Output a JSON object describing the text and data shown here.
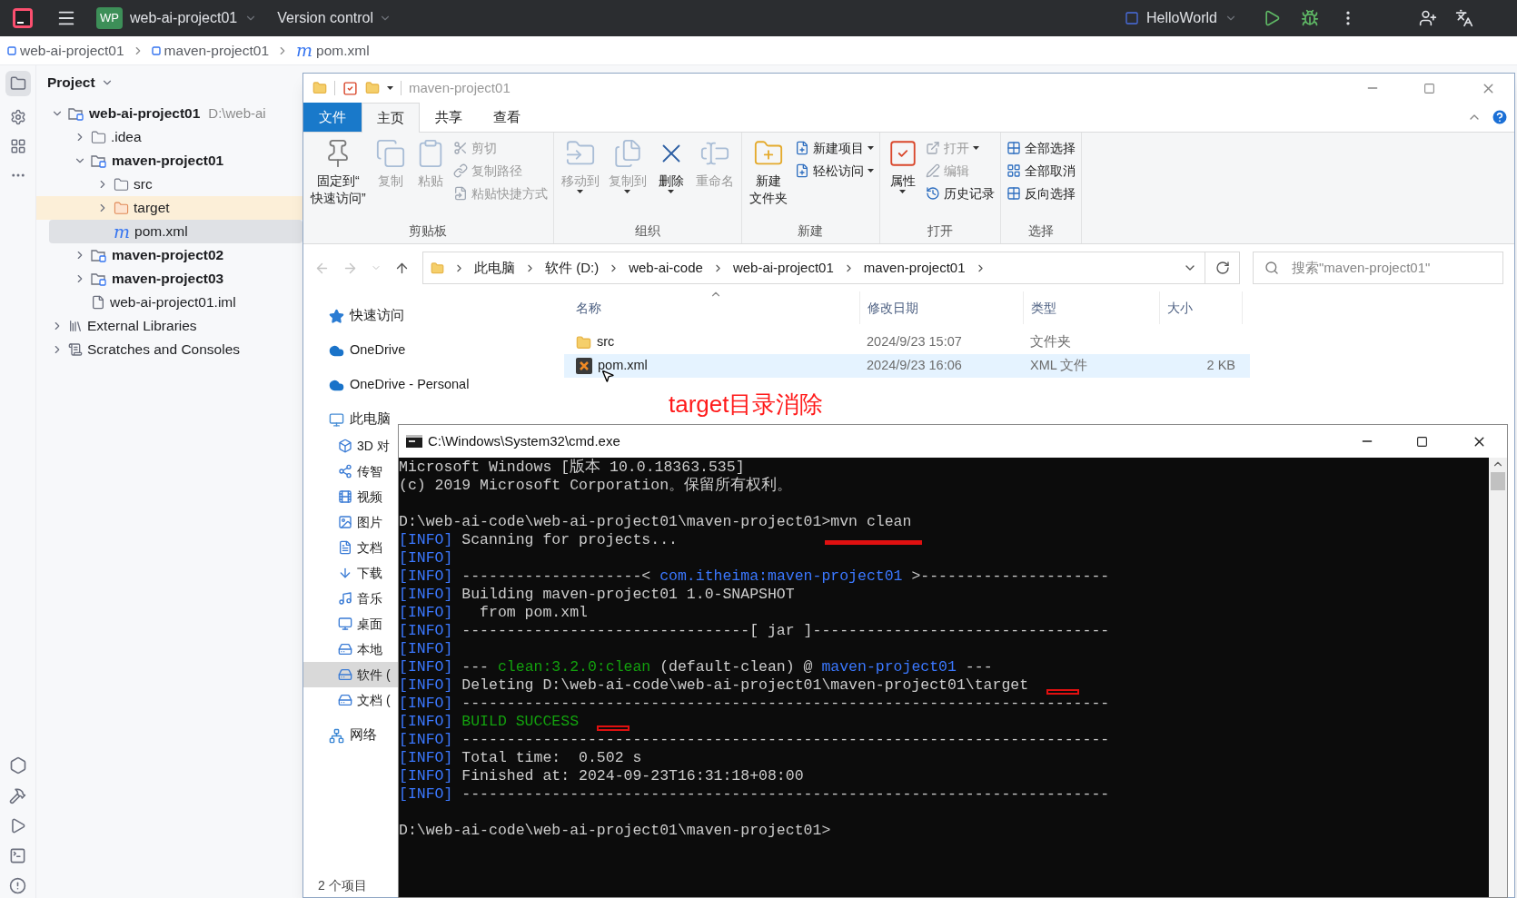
{
  "ide": {
    "top_bar": {
      "project_badge": "WP",
      "project": "web-ai-project01",
      "vcs": "Version control",
      "run_config": "HelloWorld"
    },
    "breadcrumbs": [
      {
        "label": "web-ai-project01",
        "kind": "module"
      },
      {
        "label": "maven-project01",
        "kind": "module"
      },
      {
        "label": "pom.xml",
        "kind": "maven",
        "glyph": "m"
      }
    ],
    "project_panel": {
      "title": "Project",
      "tree": [
        {
          "label": "web-ai-project01",
          "kind": "module",
          "bold": true,
          "expanded": true,
          "selected": false,
          "excluded": false,
          "suffix": "D:\\web-ai",
          "children": [
            {
              "label": ".idea",
              "kind": "folder",
              "bold": false,
              "expanded": false,
              "selected": false,
              "excluded": false
            },
            {
              "label": "maven-project01",
              "kind": "module",
              "bold": true,
              "expanded": true,
              "selected": false,
              "excluded": false,
              "children": [
                {
                  "label": "src",
                  "kind": "folder",
                  "bold": false,
                  "expanded": false,
                  "selected": false,
                  "excluded": false
                },
                {
                  "label": "target",
                  "kind": "folder",
                  "bold": false,
                  "expanded": false,
                  "selected": false,
                  "excluded": true
                },
                {
                  "label": "pom.xml",
                  "kind": "maven",
                  "glyph": "m",
                  "bold": false,
                  "selected": true,
                  "excluded": false
                }
              ]
            },
            {
              "label": "maven-project02",
              "kind": "module",
              "bold": true,
              "expanded": false,
              "selected": false,
              "excluded": false
            },
            {
              "label": "maven-project03",
              "kind": "module",
              "bold": true,
              "expanded": false,
              "selected": false,
              "excluded": false
            },
            {
              "label": "web-ai-project01.iml",
              "kind": "iml",
              "bold": false,
              "selected": false,
              "excluded": false
            }
          ]
        },
        {
          "label": "External Libraries",
          "kind": "libraries",
          "bold": false,
          "expanded": false,
          "selected": false,
          "excluded": false
        },
        {
          "label": "Scratches and Consoles",
          "kind": "scratches",
          "bold": false,
          "expanded": false,
          "selected": false,
          "excluded": false
        }
      ]
    }
  },
  "explorer": {
    "title": "maven-project01",
    "tabs": [
      {
        "label": "文件",
        "kind": "file_menu",
        "selected": false
      },
      {
        "label": "主页",
        "kind": "tab",
        "selected": true
      },
      {
        "label": "共享",
        "kind": "tab",
        "selected": false
      },
      {
        "label": "查看",
        "kind": "tab",
        "selected": false
      }
    ],
    "ribbon": [
      {
        "label": "剪贴板",
        "large": [
          {
            "lines": [
              "固定到“",
              "快速访问”"
            ],
            "disabled": false,
            "dropdown": false
          },
          {
            "label": "复制",
            "disabled": true,
            "dropdown": false
          },
          {
            "label": "粘贴",
            "disabled": true,
            "dropdown": false
          }
        ],
        "small": [
          {
            "label": "剪切",
            "disabled": true,
            "dropdown": false
          },
          {
            "label": "复制路径",
            "disabled": true,
            "dropdown": false
          },
          {
            "label": "粘贴快捷方式",
            "disabled": true,
            "dropdown": false
          }
        ]
      },
      {
        "label": "组织",
        "large": [
          {
            "label": "移动到",
            "disabled": true,
            "dropdown": true
          },
          {
            "label": "复制到",
            "disabled": true,
            "dropdown": true
          },
          {
            "label": "删除",
            "disabled": false,
            "dropdown": true
          },
          {
            "label": "重命名",
            "disabled": true,
            "dropdown": false
          }
        ]
      },
      {
        "label": "新建",
        "large": [
          {
            "lines": [
              "新建",
              "文件夹"
            ],
            "disabled": false,
            "dropdown": false
          }
        ],
        "small": [
          {
            "label": "新建项目",
            "disabled": false,
            "dropdown": true
          },
          {
            "label": "轻松访问",
            "disabled": false,
            "dropdown": true
          }
        ]
      },
      {
        "label": "打开",
        "large": [
          {
            "label": "属性",
            "disabled": false,
            "dropdown": true
          }
        ],
        "small": [
          {
            "label": "打开",
            "disabled": true,
            "dropdown": true
          },
          {
            "label": "编辑",
            "disabled": true,
            "dropdown": false
          },
          {
            "label": "历史记录",
            "disabled": false,
            "dropdown": false
          }
        ]
      },
      {
        "label": "选择",
        "small": [
          {
            "label": "全部选择",
            "disabled": false,
            "dropdown": false
          },
          {
            "label": "全部取消",
            "disabled": false,
            "dropdown": false
          },
          {
            "label": "反向选择",
            "disabled": false,
            "dropdown": false
          }
        ]
      }
    ],
    "address": [
      "此电脑",
      "软件 (D:)",
      "web-ai-code",
      "web-ai-project01",
      "maven-project01"
    ],
    "search": {
      "placeholder": "搜索\"maven-project01\""
    },
    "nav": [
      {
        "label": "快速访问",
        "selected": false
      },
      {
        "label": "OneDrive",
        "selected": false
      },
      {
        "label": "OneDrive - Personal",
        "selected": false
      },
      {
        "label": "此电脑",
        "selected": false,
        "children": [
          {
            "label": "3D 对",
            "selected": false
          },
          {
            "label": "传智",
            "selected": false
          },
          {
            "label": "视频",
            "selected": false
          },
          {
            "label": "图片",
            "selected": false
          },
          {
            "label": "文档",
            "selected": false
          },
          {
            "label": "下载",
            "selected": false
          },
          {
            "label": "音乐",
            "selected": false
          },
          {
            "label": "桌面",
            "selected": false
          },
          {
            "label": "本地",
            "selected": false
          },
          {
            "label": "软件 (",
            "selected": true
          },
          {
            "label": "文档 (",
            "selected": false
          }
        ]
      },
      {
        "label": "网络",
        "selected": false
      }
    ],
    "columns": [
      "名称",
      "修改日期",
      "类型",
      "大小"
    ],
    "files": [
      {
        "name": "src",
        "kind": "folder",
        "modified": "2024/9/23 15:07",
        "type": "文件夹",
        "selected": false
      },
      {
        "name": "pom.xml",
        "kind": "xml",
        "modified": "2024/9/23 16:06",
        "type": "XML 文件",
        "size": "2 KB",
        "selected": true
      }
    ],
    "annotation": "target目录消除",
    "status": "2 个项目"
  },
  "cmd": {
    "title": "C:\\Windows\\System32\\cmd.exe",
    "lines": [
      {
        "segments": [
          {
            "kind": "plain",
            "text": "Microsoft Windows [版本 10.0.18363.535]"
          }
        ]
      },
      {
        "segments": [
          {
            "kind": "plain",
            "text": "(c) 2019 Microsoft Corporation。保留所有权利。"
          }
        ]
      },
      {
        "blank_before": true,
        "segments": [
          {
            "kind": "plain",
            "text": "D:\\web-ai-code\\web-ai-project01\\maven-project01>"
          },
          {
            "kind": "plain",
            "text": "mvn clean",
            "marked": true
          }
        ]
      },
      {
        "segments": [
          {
            "kind": "info",
            "text": "[INFO]"
          },
          {
            "kind": "plain",
            "text": "Scanning for projects..."
          }
        ]
      },
      {
        "segments": [
          {
            "kind": "info",
            "text": "[INFO]"
          }
        ]
      },
      {
        "segments": [
          {
            "kind": "info",
            "text": "[INFO]"
          },
          {
            "kind": "plain",
            "text": "--------------------< "
          },
          {
            "kind": "blue",
            "text": "com.itheima:maven-project01"
          },
          {
            "kind": "plain",
            "text": " >---------------------"
          }
        ]
      },
      {
        "segments": [
          {
            "kind": "info",
            "text": "[INFO]"
          },
          {
            "kind": "plain",
            "text": "Building maven-project01 1.0-SNAPSHOT"
          }
        ]
      },
      {
        "segments": [
          {
            "kind": "info",
            "text": "[INFO]"
          },
          {
            "kind": "plain",
            "text": "  from pom.xml"
          }
        ]
      },
      {
        "segments": [
          {
            "kind": "info",
            "text": "[INFO]"
          },
          {
            "kind": "plain",
            "text": "--------------------------------[ jar ]---------------------------------"
          }
        ]
      },
      {
        "segments": [
          {
            "kind": "info",
            "text": "[INFO]"
          }
        ]
      },
      {
        "segments": [
          {
            "kind": "info",
            "text": "[INFO]"
          },
          {
            "kind": "plain",
            "text": "--- "
          },
          {
            "kind": "green",
            "text": "clean:3.2.0:clean"
          },
          {
            "kind": "plain",
            "text": " (default-clean) @ "
          },
          {
            "kind": "blue",
            "text": "maven-project01"
          },
          {
            "kind": "plain",
            "text": " ---"
          }
        ]
      },
      {
        "segments": [
          {
            "kind": "info",
            "text": "[INFO]"
          },
          {
            "kind": "plain",
            "text": "Deleting D:\\web-ai-code\\web-ai-project01\\maven-project01\\target"
          }
        ],
        "mark_after": true
      },
      {
        "segments": [
          {
            "kind": "info",
            "text": "[INFO]"
          },
          {
            "kind": "plain",
            "text": "------------------------------------------------------------------------"
          }
        ]
      },
      {
        "segments": [
          {
            "kind": "info",
            "text": "[INFO]"
          },
          {
            "kind": "green",
            "text": "BUILD SUCCESS"
          }
        ],
        "mark_after": true
      },
      {
        "segments": [
          {
            "kind": "info",
            "text": "[INFO]"
          },
          {
            "kind": "plain",
            "text": "------------------------------------------------------------------------"
          }
        ]
      },
      {
        "segments": [
          {
            "kind": "info",
            "text": "[INFO]"
          },
          {
            "kind": "plain",
            "text": "Total time:  0.502 s"
          }
        ]
      },
      {
        "segments": [
          {
            "kind": "info",
            "text": "[INFO]"
          },
          {
            "kind": "plain",
            "text": "Finished at: 2024-09-23T16:31:18+08:00"
          }
        ]
      },
      {
        "segments": [
          {
            "kind": "info",
            "text": "[INFO]"
          },
          {
            "kind": "plain",
            "text": "------------------------------------------------------------------------"
          }
        ]
      },
      {
        "blank_before": true,
        "segments": [
          {
            "kind": "plain",
            "text": "D:\\web-ai-code\\web-ai-project01\\maven-project01>"
          }
        ]
      }
    ]
  }
}
